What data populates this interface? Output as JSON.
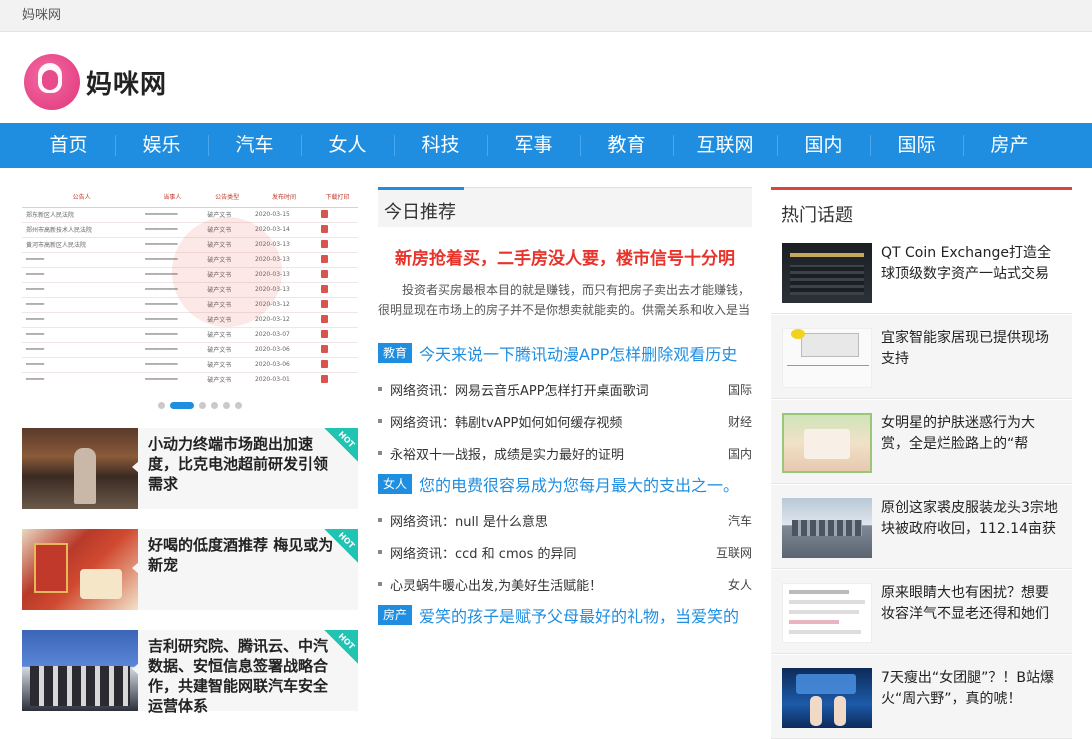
{
  "topbar": {
    "site_name": "妈咪网"
  },
  "logo": {
    "text": "妈咪网"
  },
  "nav": {
    "items": [
      "首页",
      "娱乐",
      "汽车",
      "女人",
      "科技",
      "军事",
      "教育",
      "互联网",
      "国内",
      "国际",
      "房产"
    ]
  },
  "slider": {
    "table_headers": [
      "公告人",
      "当事人",
      "公告类型",
      "发布时间",
      "下载打印"
    ],
    "rows": [
      [
        "郑东新区人民法院",
        "",
        "破产文书",
        "2020-03-15"
      ],
      [
        "郑州市高新技术人民法院",
        "",
        "破产文书",
        "2020-03-14"
      ],
      [
        "黄河市高新区人民法院",
        "",
        "破产文书",
        "2020-03-13"
      ],
      [
        "",
        "",
        "破产文书",
        "2020-03-13"
      ],
      [
        "",
        "",
        "破产文书",
        "2020-03-13"
      ],
      [
        "",
        "",
        "破产文书",
        "2020-03-13"
      ],
      [
        "",
        "",
        "破产文书",
        "2020-03-12"
      ],
      [
        "",
        "",
        "破产文书",
        "2020-03-12"
      ],
      [
        "",
        "",
        "破产文书",
        "2020-03-07"
      ],
      [
        "",
        "",
        "破产文书",
        "2020-03-06"
      ],
      [
        "",
        "",
        "破产文书",
        "2020-03-06"
      ],
      [
        "",
        "",
        "破产文书",
        "2020-03-01"
      ]
    ]
  },
  "cards": [
    {
      "title": "小动力终端市场跑出加速度，比克电池超前研发引领需求",
      "badge": "HOT"
    },
    {
      "title": "好喝的低度酒推荐 梅见或为新宠",
      "badge": "HOT"
    },
    {
      "title": "吉利研究院、腾讯云、中汽数据、安恒信息签署战略合作，共建智能网联汽车安全运营体系",
      "badge": "HOT"
    }
  ],
  "today": {
    "heading": "今日推荐",
    "headline": "新房抢着买，二手房没人要，楼市信号十分明",
    "summary": "投资者买房最根本目的就是赚钱，而只有把房子卖出去才能赚钱，很明显现在市场上的房子并不是你想卖就能卖的。供需关系和收入是当",
    "groups": [
      {
        "tag": "教育",
        "title": "今天来说一下腾讯动漫APP怎样删除观看历史",
        "items": [
          {
            "title": "网络资讯：网易云音乐APP怎样打开桌面歌词",
            "category": "国际"
          },
          {
            "title": "网络资讯：韩剧tvAPP如何如何缓存视频",
            "category": "财经"
          },
          {
            "title": "永裕双十一战报，成绩是实力最好的证明",
            "category": "国内"
          }
        ]
      },
      {
        "tag": "女人",
        "title": "您的电费很容易成为您每月最大的支出之一。",
        "items": [
          {
            "title": "网络资讯：null 是什么意思",
            "category": "汽车"
          },
          {
            "title": "网络资讯：ccd 和 cmos 的异同",
            "category": "互联网"
          },
          {
            "title": "心灵蜗牛暖心出发,为美好生活赋能！",
            "category": "女人"
          }
        ]
      },
      {
        "tag": "房产",
        "title": "爱笑的孩子是赋予父母最好的礼物，当爱笑的",
        "items": []
      }
    ]
  },
  "hot_topics": {
    "heading": "热门话题",
    "items": [
      {
        "title": "QT Coin Exchange打造全球顶级数字资产一站式交易服"
      },
      {
        "title": "宜家智能家居现已提供现场支持"
      },
      {
        "title": "女明星的护肤迷惑行为大赏，全是烂脸路上的“帮"
      },
      {
        "title": "原创这家裘皮服装龙头3宗地块被政府收回，112.14亩获"
      },
      {
        "title": "原来眼睛大也有困扰？想要妆容洋气不显老还得和她们"
      },
      {
        "title": "7天瘦出“女团腿”？！B站爆火“周六野”，真的唬！"
      }
    ]
  },
  "colors": {
    "nav_blue": "#1f8ee0",
    "headline_red": "#e8332b",
    "hot_teal": "#21c4b3",
    "hot_topics_red": "#d9453a"
  },
  "icons": {
    "hot_badge": "hot-ribbon-icon",
    "list_bullet": "square-bullet-icon"
  }
}
